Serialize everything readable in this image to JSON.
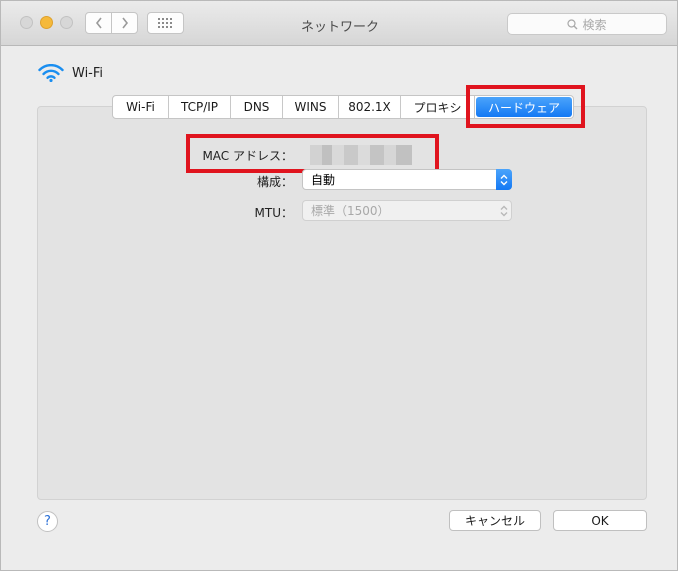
{
  "window": {
    "title": "ネットワーク"
  },
  "toolbar": {
    "back_icon": "chevron-left-icon",
    "forward_icon": "chevron-right-icon",
    "show_all_icon": "grid-icon",
    "search_placeholder": "検索"
  },
  "interface": {
    "name": "Wi-Fi",
    "icon": "wifi-icon"
  },
  "tabs": [
    {
      "label": "Wi-Fi",
      "selected": false
    },
    {
      "label": "TCP/IP",
      "selected": false
    },
    {
      "label": "DNS",
      "selected": false
    },
    {
      "label": "WINS",
      "selected": false
    },
    {
      "label": "802.1X",
      "selected": false
    },
    {
      "label": "プロキシ",
      "selected": false
    },
    {
      "label": "ハードウェア",
      "selected": true
    }
  ],
  "hardware": {
    "mac_label": "MAC アドレス：",
    "config_label": "構成：",
    "config_value": "自動",
    "mtu_label": "MTU：",
    "mtu_value": "標準（1500）"
  },
  "footer": {
    "help_label": "?",
    "cancel_label": "キャンセル",
    "ok_label": "OK"
  },
  "colors": {
    "accent": "#1a7cf5",
    "highlight_box": "#e0141e",
    "traffic_min": "#f5b93a"
  }
}
